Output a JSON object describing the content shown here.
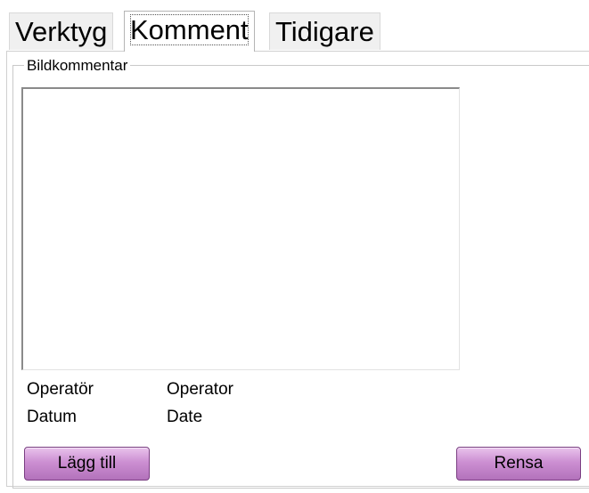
{
  "tabs": [
    {
      "label": "Verktyg",
      "active": false
    },
    {
      "label": "Komment",
      "active": true
    },
    {
      "label": "Tidigare",
      "active": false
    }
  ],
  "comment_group": {
    "legend": "Bildkommentar",
    "comment_value": ""
  },
  "info": {
    "operator_label": "Operatör",
    "operator_value": "Operator",
    "date_label": "Datum",
    "date_value": "Date"
  },
  "buttons": {
    "add_label": "Lägg till",
    "clear_label": "Rensa"
  },
  "colors": {
    "button_gradient_top": "#e9c3ec",
    "button_gradient_bottom": "#b372bb",
    "button_border": "#7a3f82"
  }
}
